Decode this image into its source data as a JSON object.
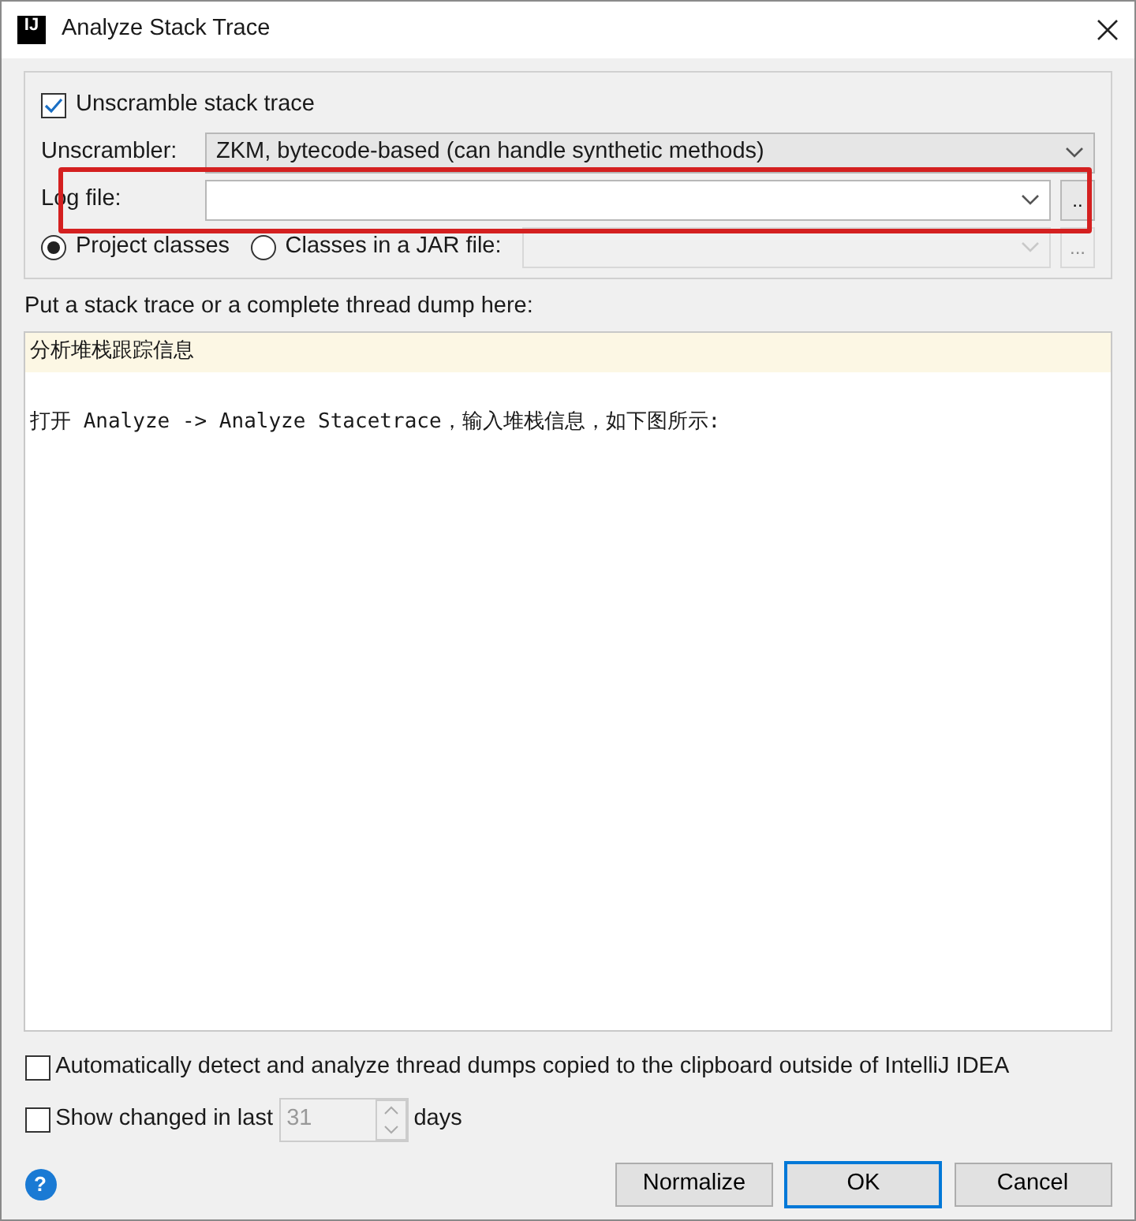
{
  "window": {
    "logo": "IJ",
    "title": "Analyze Stack Trace"
  },
  "unscramble": {
    "label": "Unscramble stack trace",
    "checked": true
  },
  "unscrambler": {
    "label": "Unscrambler:",
    "value": "ZKM, bytecode-based (can handle synthetic methods)"
  },
  "log_file": {
    "label": "Log file:",
    "browse": "..",
    "highlighted": true
  },
  "classes": [
    {
      "label": "Project classes",
      "selected": true
    },
    {
      "label": "Classes in a JAR file:",
      "selected": false
    }
  ],
  "jar_browse": {
    "label": "...",
    "disabled": true
  },
  "prompt": "Put a stack trace or a complete thread dump here:",
  "trace_lines": [
    {
      "text": "分析堆栈跟踪信息",
      "current": true
    },
    {
      "text": "打开 Analyze -> Analyze Stacetrace，输入堆栈信息，如下图所示:",
      "current": false
    }
  ],
  "options": [
    {
      "kind": "plain",
      "label": "Automatically detect and analyze thread dumps copied to the clipboard outside of IntelliJ IDEA",
      "checked": false
    },
    {
      "kind": "days",
      "label": "Show changed in last",
      "value": "31",
      "suffix": "days",
      "checked": false,
      "disabled": true
    }
  ],
  "help": "?",
  "buttons": [
    {
      "label": "Normalize",
      "default": false
    },
    {
      "label": "OK",
      "default": true
    },
    {
      "label": "Cancel",
      "default": false
    }
  ]
}
